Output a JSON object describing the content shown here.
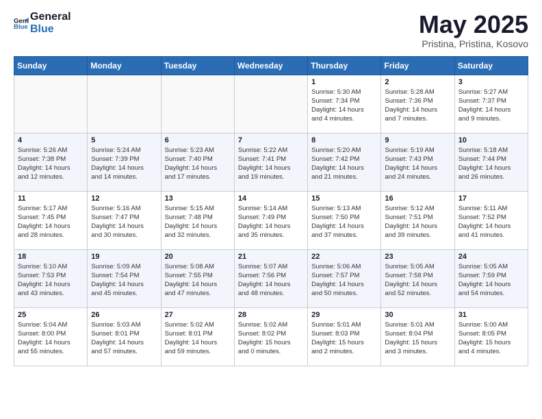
{
  "logo": {
    "line1": "General",
    "line2": "Blue"
  },
  "title": "May 2025",
  "location": "Pristina, Pristina, Kosovo",
  "days_of_week": [
    "Sunday",
    "Monday",
    "Tuesday",
    "Wednesday",
    "Thursday",
    "Friday",
    "Saturday"
  ],
  "weeks": [
    [
      {
        "day": "",
        "info": ""
      },
      {
        "day": "",
        "info": ""
      },
      {
        "day": "",
        "info": ""
      },
      {
        "day": "",
        "info": ""
      },
      {
        "day": "1",
        "info": "Sunrise: 5:30 AM\nSunset: 7:34 PM\nDaylight: 14 hours\nand 4 minutes."
      },
      {
        "day": "2",
        "info": "Sunrise: 5:28 AM\nSunset: 7:36 PM\nDaylight: 14 hours\nand 7 minutes."
      },
      {
        "day": "3",
        "info": "Sunrise: 5:27 AM\nSunset: 7:37 PM\nDaylight: 14 hours\nand 9 minutes."
      }
    ],
    [
      {
        "day": "4",
        "info": "Sunrise: 5:26 AM\nSunset: 7:38 PM\nDaylight: 14 hours\nand 12 minutes."
      },
      {
        "day": "5",
        "info": "Sunrise: 5:24 AM\nSunset: 7:39 PM\nDaylight: 14 hours\nand 14 minutes."
      },
      {
        "day": "6",
        "info": "Sunrise: 5:23 AM\nSunset: 7:40 PM\nDaylight: 14 hours\nand 17 minutes."
      },
      {
        "day": "7",
        "info": "Sunrise: 5:22 AM\nSunset: 7:41 PM\nDaylight: 14 hours\nand 19 minutes."
      },
      {
        "day": "8",
        "info": "Sunrise: 5:20 AM\nSunset: 7:42 PM\nDaylight: 14 hours\nand 21 minutes."
      },
      {
        "day": "9",
        "info": "Sunrise: 5:19 AM\nSunset: 7:43 PM\nDaylight: 14 hours\nand 24 minutes."
      },
      {
        "day": "10",
        "info": "Sunrise: 5:18 AM\nSunset: 7:44 PM\nDaylight: 14 hours\nand 26 minutes."
      }
    ],
    [
      {
        "day": "11",
        "info": "Sunrise: 5:17 AM\nSunset: 7:45 PM\nDaylight: 14 hours\nand 28 minutes."
      },
      {
        "day": "12",
        "info": "Sunrise: 5:16 AM\nSunset: 7:47 PM\nDaylight: 14 hours\nand 30 minutes."
      },
      {
        "day": "13",
        "info": "Sunrise: 5:15 AM\nSunset: 7:48 PM\nDaylight: 14 hours\nand 32 minutes."
      },
      {
        "day": "14",
        "info": "Sunrise: 5:14 AM\nSunset: 7:49 PM\nDaylight: 14 hours\nand 35 minutes."
      },
      {
        "day": "15",
        "info": "Sunrise: 5:13 AM\nSunset: 7:50 PM\nDaylight: 14 hours\nand 37 minutes."
      },
      {
        "day": "16",
        "info": "Sunrise: 5:12 AM\nSunset: 7:51 PM\nDaylight: 14 hours\nand 39 minutes."
      },
      {
        "day": "17",
        "info": "Sunrise: 5:11 AM\nSunset: 7:52 PM\nDaylight: 14 hours\nand 41 minutes."
      }
    ],
    [
      {
        "day": "18",
        "info": "Sunrise: 5:10 AM\nSunset: 7:53 PM\nDaylight: 14 hours\nand 43 minutes."
      },
      {
        "day": "19",
        "info": "Sunrise: 5:09 AM\nSunset: 7:54 PM\nDaylight: 14 hours\nand 45 minutes."
      },
      {
        "day": "20",
        "info": "Sunrise: 5:08 AM\nSunset: 7:55 PM\nDaylight: 14 hours\nand 47 minutes."
      },
      {
        "day": "21",
        "info": "Sunrise: 5:07 AM\nSunset: 7:56 PM\nDaylight: 14 hours\nand 48 minutes."
      },
      {
        "day": "22",
        "info": "Sunrise: 5:06 AM\nSunset: 7:57 PM\nDaylight: 14 hours\nand 50 minutes."
      },
      {
        "day": "23",
        "info": "Sunrise: 5:05 AM\nSunset: 7:58 PM\nDaylight: 14 hours\nand 52 minutes."
      },
      {
        "day": "24",
        "info": "Sunrise: 5:05 AM\nSunset: 7:59 PM\nDaylight: 14 hours\nand 54 minutes."
      }
    ],
    [
      {
        "day": "25",
        "info": "Sunrise: 5:04 AM\nSunset: 8:00 PM\nDaylight: 14 hours\nand 55 minutes."
      },
      {
        "day": "26",
        "info": "Sunrise: 5:03 AM\nSunset: 8:01 PM\nDaylight: 14 hours\nand 57 minutes."
      },
      {
        "day": "27",
        "info": "Sunrise: 5:02 AM\nSunset: 8:01 PM\nDaylight: 14 hours\nand 59 minutes."
      },
      {
        "day": "28",
        "info": "Sunrise: 5:02 AM\nSunset: 8:02 PM\nDaylight: 15 hours\nand 0 minutes."
      },
      {
        "day": "29",
        "info": "Sunrise: 5:01 AM\nSunset: 8:03 PM\nDaylight: 15 hours\nand 2 minutes."
      },
      {
        "day": "30",
        "info": "Sunrise: 5:01 AM\nSunset: 8:04 PM\nDaylight: 15 hours\nand 3 minutes."
      },
      {
        "day": "31",
        "info": "Sunrise: 5:00 AM\nSunset: 8:05 PM\nDaylight: 15 hours\nand 4 minutes."
      }
    ]
  ]
}
